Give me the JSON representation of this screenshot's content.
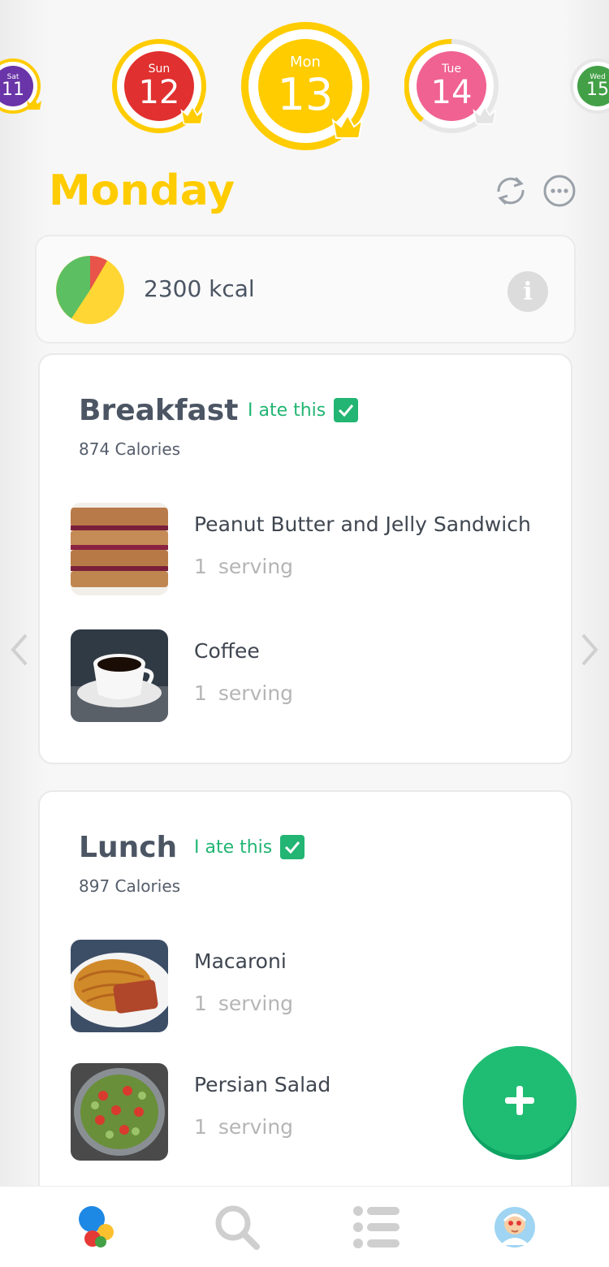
{
  "day_strip": [
    {
      "day": "Sat",
      "date": "11",
      "color": "#6a35a8",
      "ring": "#ffcc00"
    },
    {
      "day": "Sun",
      "date": "12",
      "color": "#e0302f",
      "ring": "#ffcc00"
    },
    {
      "day": "Mon",
      "date": "13",
      "color": "#ffcc00",
      "ring": "#ffcc00",
      "selected": true
    },
    {
      "day": "Tue",
      "date": "14",
      "color": "#f06292",
      "ring": "#ffcc00"
    },
    {
      "day": "Wed",
      "date": "15",
      "color": "#43a047",
      "ring": "#e6e6e6"
    }
  ],
  "header": {
    "title": "Monday",
    "refresh_icon": "refresh-icon",
    "more_icon": "more-icon"
  },
  "summary": {
    "calories": "2300 kcal",
    "info_label": "i",
    "macro_colors": [
      "#5cbf62",
      "#ffd633",
      "#e8534a"
    ]
  },
  "meals": [
    {
      "title": "Breakfast",
      "ate_label": "I ate this",
      "calories": "874 Calories",
      "foods": [
        {
          "name": "Peanut Butter and Jelly Sandwich",
          "quantity": "1",
          "unit": "serving"
        },
        {
          "name": "Coffee",
          "quantity": "1",
          "unit": "serving"
        }
      ]
    },
    {
      "title": "Lunch",
      "ate_label": "I ate this",
      "calories": "897 Calories",
      "foods": [
        {
          "name": "Macaroni",
          "quantity": "1",
          "unit": "serving"
        },
        {
          "name": "Persian Salad",
          "quantity": "1",
          "unit": "serving"
        }
      ]
    }
  ],
  "fab": {
    "icon": "plus-icon",
    "color": "#1fbd73"
  },
  "nav": [
    {
      "name": "home-icon",
      "active": true
    },
    {
      "name": "search-icon"
    },
    {
      "name": "list-icon"
    },
    {
      "name": "profile-avatar-icon"
    }
  ]
}
